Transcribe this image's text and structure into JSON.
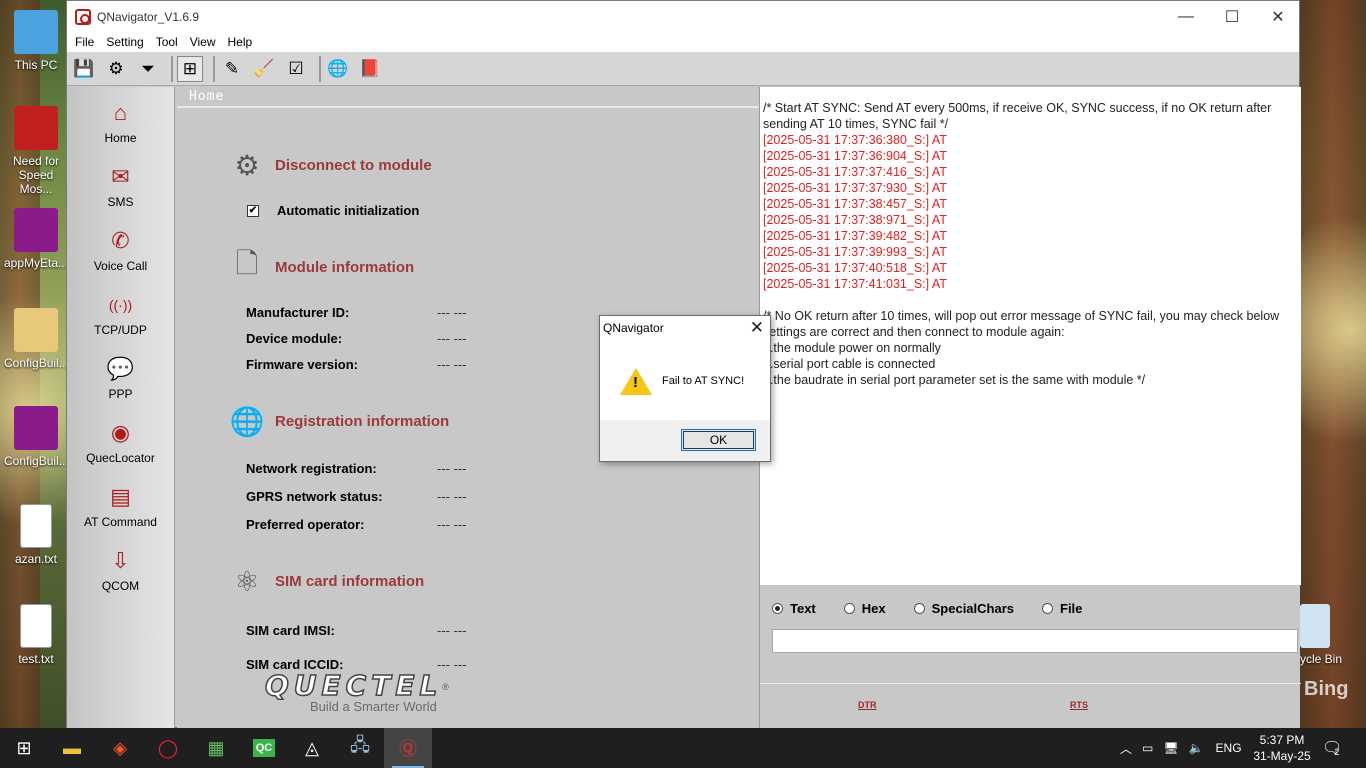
{
  "desktop": {
    "icons": [
      {
        "label": "This PC",
        "color": "#4aa3df"
      },
      {
        "label": "Need for Speed Mos...",
        "color": "#c02020"
      },
      {
        "label": "appMyEta...",
        "color": "#8b1a8b"
      },
      {
        "label": "ConfigBuil...",
        "color": "#e8c87a"
      },
      {
        "label": "ConfigBuil...",
        "color": "#8b1a8b"
      },
      {
        "label": "azan.txt",
        "color": "#ffffff"
      },
      {
        "label": "test.txt",
        "color": "#ffffff"
      }
    ],
    "recycle_label": "ycle Bin",
    "bing_label": "Bing"
  },
  "window": {
    "title": "QNavigator_V1.6.9",
    "minimize": "—",
    "maximize": "☐",
    "close": "✕"
  },
  "menu": [
    "File",
    "Setting",
    "Tool",
    "View",
    "Help"
  ],
  "toolbar": {
    "icons": [
      "save-icon",
      "settings-icon",
      "filter-icon",
      "home-page-icon",
      "edit-icon",
      "clear-icon",
      "checklist-icon",
      "globe-icon",
      "help-book-icon"
    ]
  },
  "nav": [
    {
      "label": "Home",
      "icon": "home-icon",
      "glyph": "⌂"
    },
    {
      "label": "SMS",
      "icon": "sms-icon",
      "glyph": "✉"
    },
    {
      "label": "Voice Call",
      "icon": "phone-icon",
      "glyph": "✆"
    },
    {
      "label": "TCP/UDP",
      "icon": "wifi-icon",
      "glyph": "((·))"
    },
    {
      "label": "PPP",
      "icon": "ppp-icon",
      "glyph": "💬"
    },
    {
      "label": "QuecLocator",
      "icon": "locator-icon",
      "glyph": "◉"
    },
    {
      "label": "AT Command",
      "icon": "at-command-icon",
      "glyph": "▤"
    },
    {
      "label": "QCOM",
      "icon": "qcom-icon",
      "glyph": "⇩"
    }
  ],
  "home": {
    "header": "Home",
    "disconnect": "Disconnect to module",
    "auto_init": "Automatic initialization",
    "auto_init_checked": true,
    "module_info": "Module information",
    "manufacturer_label": "Manufacturer ID:",
    "manufacturer_val": "--- ---",
    "device_label": "Device module:",
    "device_val": "--- ---",
    "firmware_label": "Firmware version:",
    "firmware_val": "--- ---",
    "registration_info": "Registration information",
    "netreg_label": "Network registration:",
    "netreg_val": "--- ---",
    "gprs_label": "GPRS network status:",
    "gprs_val": "--- ---",
    "operator_label": "Preferred operator:",
    "operator_val": "--- ---",
    "sim_info": "SIM card information",
    "imsi_label": "SIM card IMSI:",
    "imsi_val": "--- ---",
    "iccid_label": "SIM card ICCID:",
    "iccid_val": "--- ---"
  },
  "logo": {
    "brand": "QUECTEL",
    "reg": "®",
    "slogan": "Build a Smarter World"
  },
  "log": {
    "intro": "/* Start AT SYNC: Send AT every 500ms, if receive OK, SYNC success, if no OK return after sending AT 10 times, SYNC fail */",
    "lines": [
      "[2025-05-31 17:37:36:380_S:] AT",
      "[2025-05-31 17:37:36:904_S:] AT",
      "[2025-05-31 17:37:37:416_S:] AT",
      "[2025-05-31 17:37:37:930_S:] AT",
      "[2025-05-31 17:37:38:457_S:] AT",
      "[2025-05-31 17:37:38:971_S:] AT",
      "[2025-05-31 17:37:39:482_S:] AT",
      "[2025-05-31 17:37:39:993_S:] AT",
      "[2025-05-31 17:37:40:518_S:] AT",
      "[2025-05-31 17:37:41:031_S:] AT"
    ],
    "outro": [
      "/* No OK return after 10 times, will pop out error message of SYNC fail, you may check below settings are correct and then connect to module again:",
      "1.the module power on normally",
      "2.serial port cable is connected",
      "3.the baudrate in serial port parameter set is the same with module */"
    ]
  },
  "send": {
    "options": [
      "Text",
      "Hex",
      "SpecialChars",
      "File"
    ],
    "selected": "Text",
    "value": ""
  },
  "controls": {
    "dtr": "DTR",
    "rts": "RTS"
  },
  "dialog": {
    "title": "QNavigator",
    "message": "Fail to AT SYNC!",
    "ok": "OK",
    "close": "✕"
  },
  "taskbar": {
    "apps": [
      "windows-start-icon",
      "file-explorer-icon",
      "brave-browser-icon",
      "opera-browser-icon",
      "notepad-icon",
      "qc-app-icon",
      "unity-icon",
      "network-app-icon",
      "qnavigator-icon"
    ],
    "qc_label": "QC",
    "lang": "ENG",
    "time": "5:37 PM",
    "date": "31-May-25",
    "notifications": "2"
  }
}
